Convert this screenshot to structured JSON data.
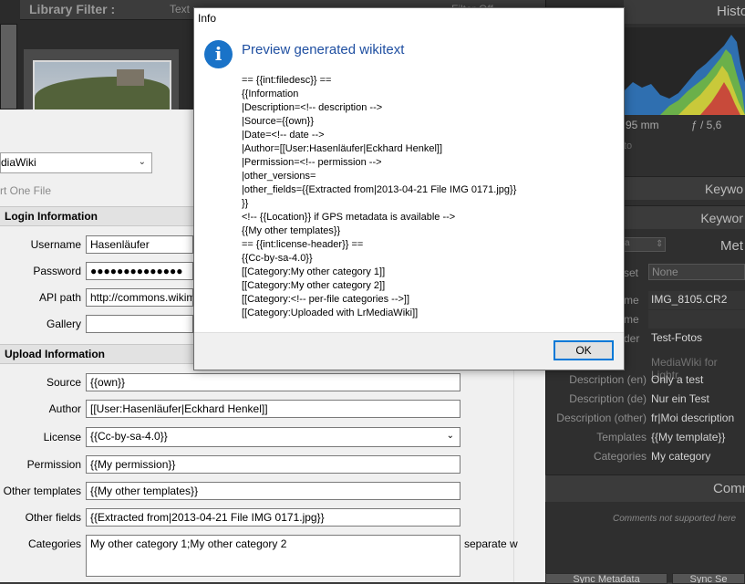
{
  "lightroom": {
    "filter_title": "Library Filter :",
    "filter_text": "Text",
    "filter_offs": "Filter Off",
    "histogram_title": "Histo",
    "focal_length": "95 mm",
    "aperture": "ƒ / 5,6",
    "to_label": "to",
    "panel_bars": [
      "Keywo",
      "Keywor"
    ],
    "metadata_title": "Met",
    "metadata_dropdown": "a",
    "preset_label": "set",
    "preset_value": "None",
    "fields": [
      {
        "label": "me",
        "value": "IMG_8105.CR2"
      },
      {
        "label": "me",
        "value": ""
      },
      {
        "label": "der",
        "value": "Test-Fotos"
      }
    ],
    "mediawiki_section": "MediaWiki for Lightr",
    "mw_fields": [
      {
        "label": "Description (en)",
        "value": "Only a test"
      },
      {
        "label": "Description (de)",
        "value": "Nur ein Test"
      },
      {
        "label": "Description (other)",
        "value": "fr|Moi description"
      },
      {
        "label": "Templates",
        "value": "{{My template}}"
      },
      {
        "label": "Categories",
        "value": "My category"
      }
    ],
    "comments_title": "Comm",
    "comments_note": "Comments not supported here",
    "bottom_buttons": [
      "Sync Metadata",
      "Sync Se"
    ]
  },
  "plugin": {
    "service_select": "diaWiki",
    "export_one": "rt One File",
    "login_section": "Login Information",
    "login": [
      {
        "label": "Username",
        "value": "Hasenläufer"
      },
      {
        "label": "Password",
        "value": "●●●●●●●●●●●●●●"
      },
      {
        "label": "API path",
        "value": "http://commons.wikimedia"
      },
      {
        "label": "Gallery",
        "value": ""
      }
    ],
    "upload_section": "Upload Information",
    "upload": [
      {
        "label": "Source",
        "value": "{{own}}"
      },
      {
        "label": "Author",
        "value": "[[User:Hasenläufer|Eckhard Henkel]]"
      },
      {
        "label": "License",
        "value": "{{Cc-by-sa-4.0}}"
      },
      {
        "label": "Permission",
        "value": "{{My permission}}"
      },
      {
        "label": "Other templates",
        "value": "{{My other templates}}"
      },
      {
        "label": "Other fields",
        "value": "{{Extracted from|2013-04-21 File IMG 0171.jpg}}"
      },
      {
        "label": "Categories",
        "value": "My other category 1;My other category 2"
      }
    ],
    "separate_hint": "separate w"
  },
  "info_dialog": {
    "title": "Info",
    "heading": "Preview generated wikitext",
    "body": "== {{int:filedesc}} ==\n{{Information\n|Description=<!-- description -->\n|Source={{own}}\n|Date=<!-- date -->\n|Author=[[User:Hasenläufer|Eckhard Henkel]]\n|Permission=<!-- permission -->\n|other_versions=\n|other_fields={{Extracted from|2013-04-21 File IMG 0171.jpg}}\n}}\n<!-- {{Location}} if GPS metadata is available -->\n{{My other templates}}\n== {{int:license-header}} ==\n{{Cc-by-sa-4.0}}\n[[Category:My other category 1]]\n[[Category:My other category 2]]\n[[Category:<!-- per-file categories -->]]\n[[Category:Uploaded with LrMediaWiki]]",
    "ok_label": "OK"
  },
  "colors": {
    "info_accent": "#1a73c8",
    "heading": "#1f4fa1",
    "ok_border": "#0078d7"
  }
}
